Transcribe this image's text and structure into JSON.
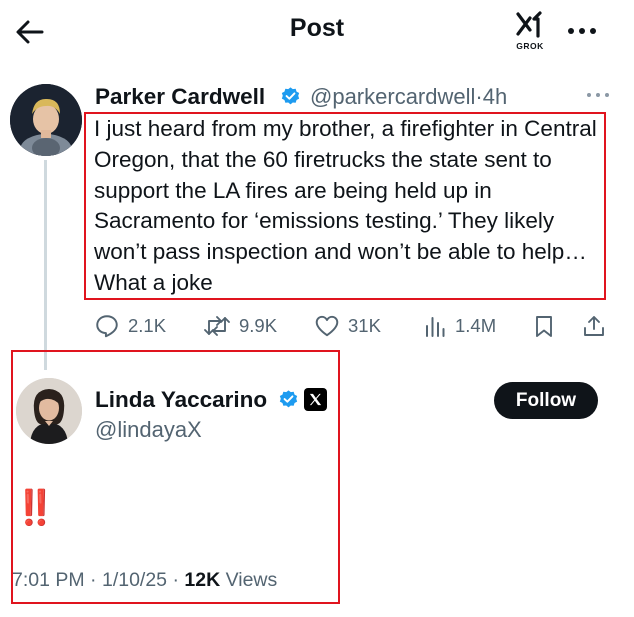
{
  "header": {
    "title": "Post",
    "grok_label": "GROK"
  },
  "tweet": {
    "author_name": "Parker Cardwell",
    "author_handle": "@parkercardwell",
    "separator": "·",
    "time_ago": "4h",
    "text": "I just heard from my brother, a firefighter in Central Oregon, that the 60 firetrucks the state sent to support the LA fires are being held up in Sacramento for ‘emissions testing.’ They likely won’t pass inspection and won’t be able to help… What a joke",
    "actions": {
      "replies": "2.1K",
      "reposts": "9.9K",
      "likes": "31K",
      "views": "1.4M"
    }
  },
  "reply": {
    "author_name": "Linda Yaccarino",
    "author_handle": "@lindayaX",
    "follow_label": "Follow",
    "text": "‼️",
    "time": "7:01 PM",
    "date": "1/10/25",
    "views_count": "12K",
    "views_label": "Views"
  },
  "colors": {
    "text_primary": "#0f1419",
    "text_secondary": "#536471",
    "verified_blue": "#1d9bf0",
    "highlight_red": "#e0141e"
  },
  "icons": [
    "back-arrow-icon",
    "grok-logo-icon",
    "more-icon",
    "verified-badge-icon",
    "reply-icon",
    "repost-icon",
    "like-icon",
    "views-icon",
    "bookmark-icon",
    "share-icon",
    "x-logo-icon"
  ]
}
